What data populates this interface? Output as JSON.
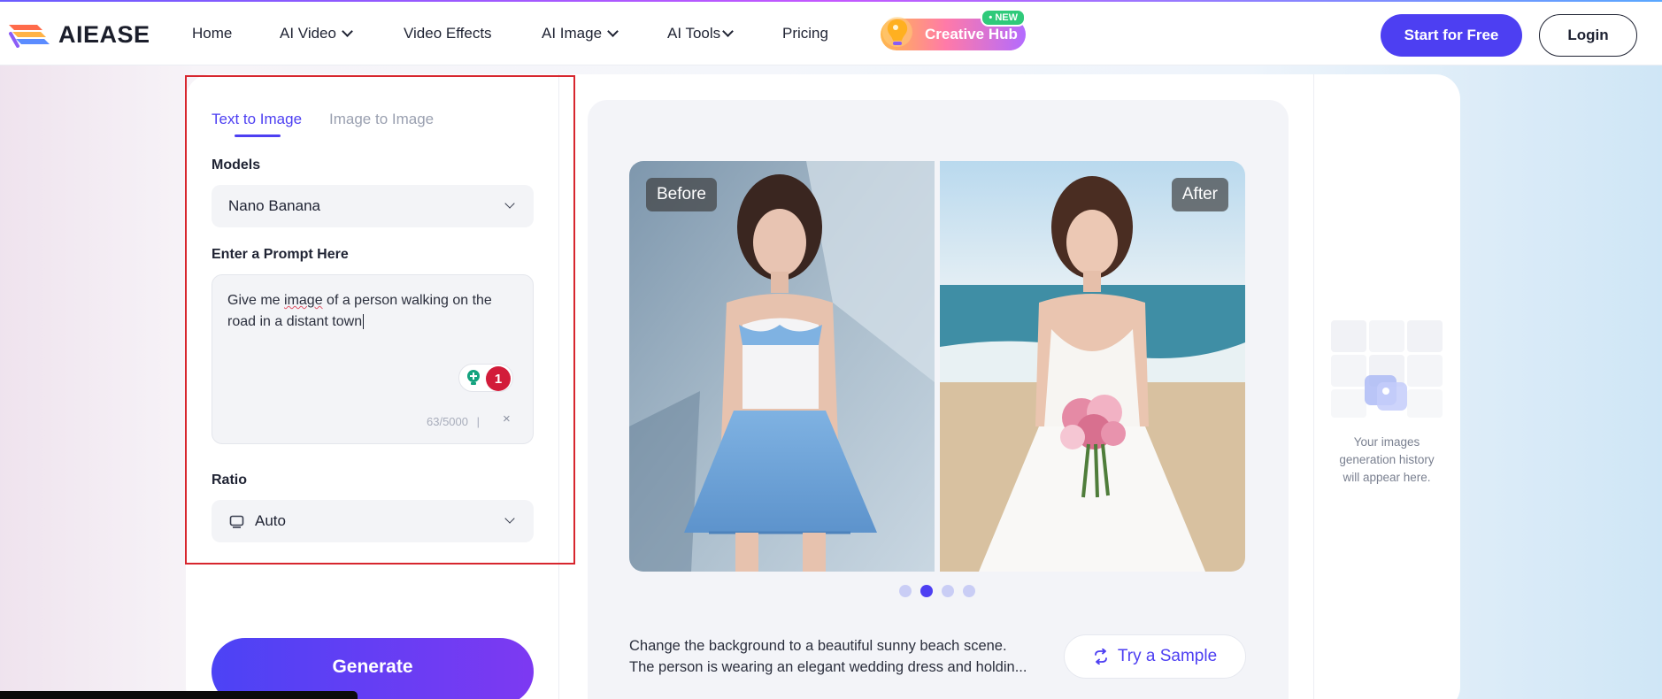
{
  "brand": {
    "name": "AIEASE"
  },
  "nav": {
    "items": [
      {
        "label": "Home",
        "dropdown": false
      },
      {
        "label": "AI Video",
        "dropdown": true
      },
      {
        "label": "Video Effects",
        "dropdown": false
      },
      {
        "label": "AI Image",
        "dropdown": true
      },
      {
        "label": "AI Tools",
        "dropdown": true
      },
      {
        "label": "Pricing",
        "dropdown": false
      }
    ],
    "creative_hub": {
      "label": "Creative Hub",
      "badge": "• NEW"
    },
    "start_label": "Start for Free",
    "login_label": "Login"
  },
  "tabs": {
    "active": "Text to Image",
    "inactive": "Image to Image"
  },
  "models": {
    "label": "Models",
    "value": "Nano Banana"
  },
  "prompt": {
    "label": "Enter a Prompt Here",
    "text_before": "Give me ",
    "text_underlined": "image",
    "text_after": " of a person walking on the road in a distant town",
    "char_count": "63/5000",
    "separator": "|",
    "clear_symbol": "×",
    "grammar_badge": "1"
  },
  "ratio": {
    "label": "Ratio",
    "value": "Auto"
  },
  "generate_label": "Generate",
  "preview": {
    "before_label": "Before",
    "after_label": "After",
    "carousel": {
      "count": 4,
      "active_index": 1
    },
    "caption_line1": "Change the background to a beautiful sunny beach scene.",
    "caption_line2": "The person is wearing an elegant wedding dress and holdin...",
    "try_label": "Try a Sample"
  },
  "history": {
    "empty_text": "Your images generation history will appear here."
  },
  "colors": {
    "accent": "#4d3ff2",
    "highlight": "#d7262e"
  }
}
